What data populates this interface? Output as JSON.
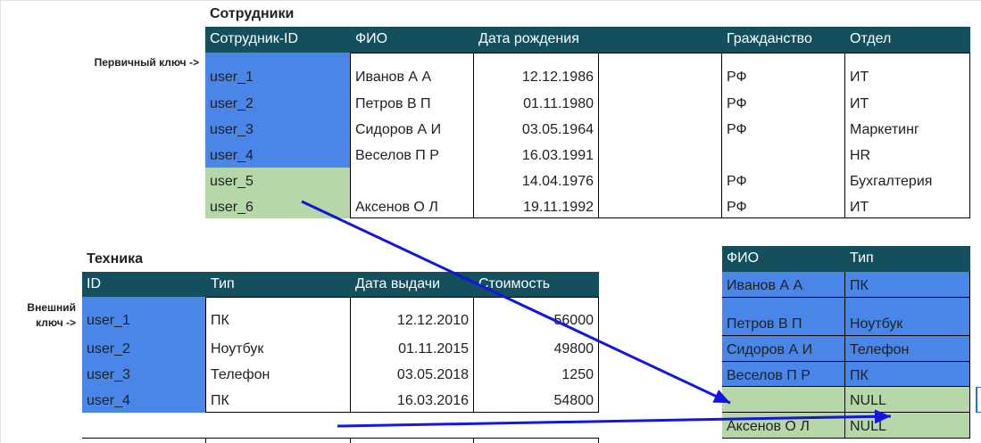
{
  "employees": {
    "title": "Сотрудники",
    "headers": [
      "Сотрудник-ID",
      "ФИО",
      "Дата рождения",
      "",
      "Гражданство",
      "Отдел"
    ],
    "rows": [
      [
        "user_1",
        "Иванов А А",
        "12.12.1986",
        "",
        "РФ",
        "ИТ"
      ],
      [
        "user_2",
        "Петров В П",
        "01.11.1980",
        "",
        "РФ",
        "ИТ"
      ],
      [
        "user_3",
        "Сидоров А И",
        "03.05.1964",
        "",
        "РФ",
        "Маркетинг"
      ],
      [
        "user_4",
        "Веселов П Р",
        "16.03.1991",
        "",
        "",
        "HR"
      ],
      [
        "user_5",
        "",
        "14.04.1976",
        "",
        "РФ",
        "Бухгалтерия"
      ],
      [
        "user_6",
        "Аксенов О Л",
        "19.11.1992",
        "",
        "РФ",
        "ИТ"
      ]
    ],
    "primary_key_label": "Первичный ключ ->"
  },
  "equipment": {
    "title": "Техника",
    "headers": [
      "ID",
      "Тип",
      "Дата выдачи",
      "Стоимость"
    ],
    "rows": [
      [
        "user_1",
        "ПК",
        "12.12.2010",
        "56000"
      ],
      [
        "user_2",
        "Ноутбук",
        "01.11.2015",
        "49800"
      ],
      [
        "user_3",
        "Телефон",
        "03.05.2018",
        "1250"
      ],
      [
        "user_4",
        "ПК",
        "16.03.2016",
        "54800"
      ]
    ],
    "foreign_key_label": "Внешний ключ ->"
  },
  "result": {
    "headers": [
      "ФИО",
      "Тип"
    ],
    "rows": [
      [
        "Иванов А А",
        "ПК"
      ],
      [
        "Петров В П",
        "Ноутбук"
      ],
      [
        "Сидоров А И",
        "Телефон"
      ],
      [
        "Веселов П Р",
        "ПК"
      ],
      [
        "",
        "NULL"
      ],
      [
        "Аксенов О Л",
        "NULL"
      ]
    ]
  },
  "colors": {
    "header_bg": "#134f5c",
    "key_blue": "#4a86e8",
    "unmatched_green": "#b6d7a8",
    "arrow": "#1515e0"
  }
}
